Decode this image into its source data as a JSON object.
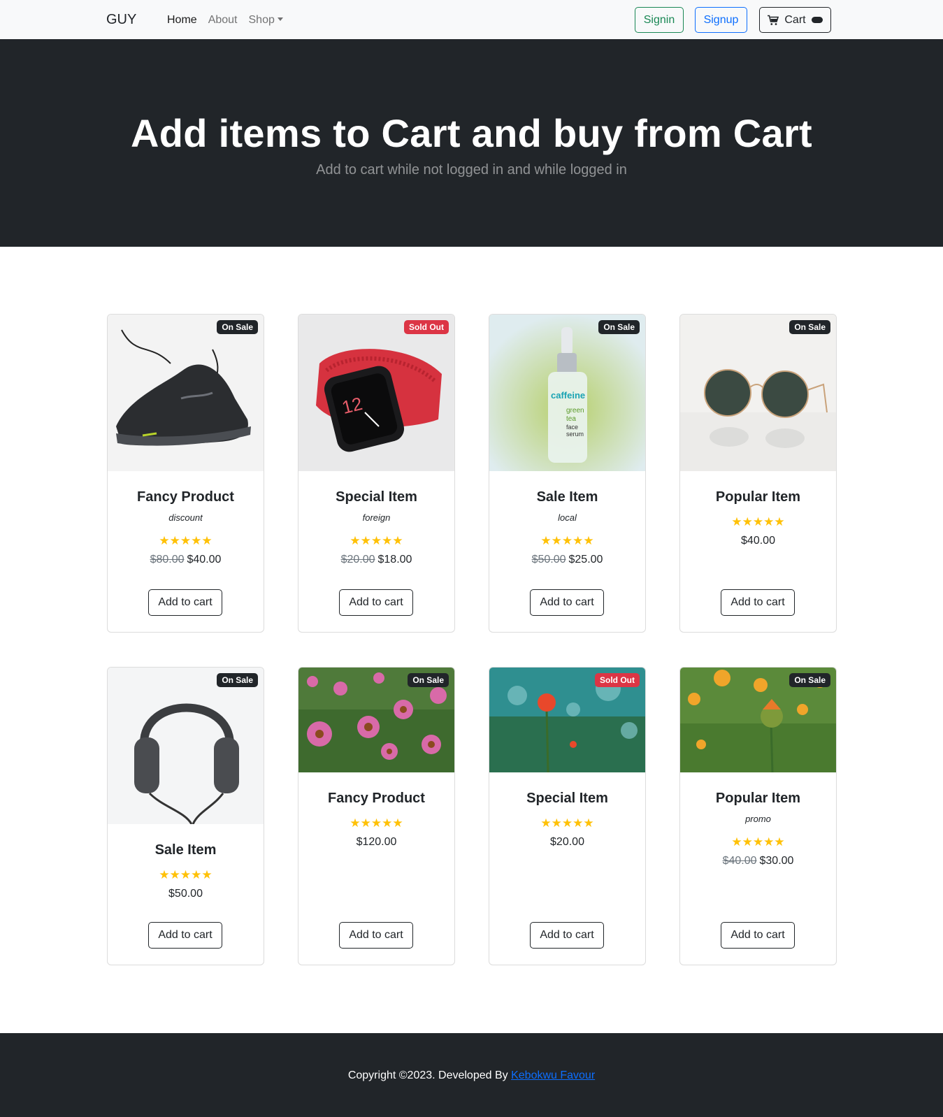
{
  "nav": {
    "brand": "GUY",
    "links": [
      {
        "label": "Home"
      },
      {
        "label": "About"
      },
      {
        "label": "Shop"
      }
    ],
    "signin_label": "Signin",
    "signup_label": "Signup",
    "cart_label": "Cart"
  },
  "hero": {
    "title": "Add items to Cart and buy from Cart",
    "subtitle": "Add to cart while not logged in and while logged in"
  },
  "products": [
    {
      "title": "Fancy Product",
      "subtitle": "discount",
      "stars": "★★★★★",
      "old_price": "$80.00",
      "price": "$40.00",
      "badge": "On Sale",
      "badge_color": "#212529",
      "button": "Add to cart",
      "image": "sneaker"
    },
    {
      "title": "Special Item",
      "subtitle": "foreign",
      "stars": "★★★★★",
      "old_price": "$20.00",
      "price": "$18.00",
      "badge": "Sold Out",
      "badge_color": "#dc3545",
      "button": "Add to cart",
      "image": "smartwatch"
    },
    {
      "title": "Sale Item",
      "subtitle": "local",
      "stars": "★★★★★",
      "old_price": "$50.00",
      "price": "$25.00",
      "badge": "On Sale",
      "badge_color": "#212529",
      "button": "Add to cart",
      "image": "serum-bottle"
    },
    {
      "title": "Popular Item",
      "subtitle": "",
      "stars": "★★★★★",
      "old_price": "",
      "price": "$40.00",
      "badge": "On Sale",
      "badge_color": "#212529",
      "button": "Add to cart",
      "image": "sunglasses"
    },
    {
      "title": "Sale Item",
      "subtitle": "",
      "stars": "★★★★★",
      "old_price": "",
      "price": "$50.00",
      "badge": "On Sale",
      "badge_color": "#212529",
      "button": "Add to cart",
      "image": "headphones"
    },
    {
      "title": "Fancy Product",
      "subtitle": "",
      "stars": "★★★★★",
      "old_price": "",
      "price": "$120.00",
      "badge": "On Sale",
      "badge_color": "#212529",
      "button": "Add to cart",
      "image": "pink-flowers"
    },
    {
      "title": "Special Item",
      "subtitle": "",
      "stars": "★★★★★",
      "old_price": "",
      "price": "$20.00",
      "badge": "Sold Out",
      "badge_color": "#dc3545",
      "button": "Add to cart",
      "image": "red-poppy"
    },
    {
      "title": "Popular Item",
      "subtitle": "promo",
      "stars": "★★★★★",
      "old_price": "$40.00",
      "price": "$30.00",
      "badge": "On Sale",
      "badge_color": "#212529",
      "button": "Add to cart",
      "image": "orange-flowers"
    }
  ],
  "footer": {
    "text": "Copyright ©2023. Developed By ",
    "link": "Kebokwu Favour"
  }
}
